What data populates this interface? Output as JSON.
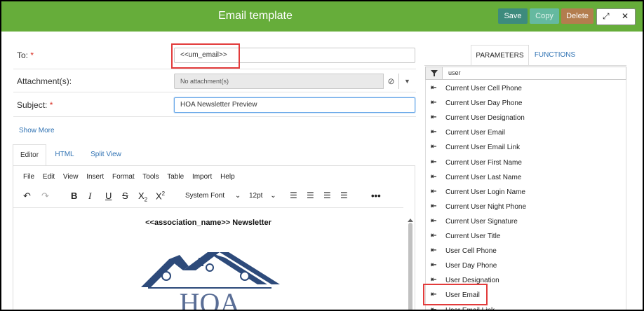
{
  "header": {
    "title": "Email template",
    "save_label": "Save",
    "copy_label": "Copy",
    "delete_label": "Delete",
    "expand_icon": "expand-icon",
    "close_icon": "close-icon"
  },
  "form": {
    "to_label": "To:",
    "to_value": "<<um_email>>",
    "attachments_label": "Attachment(s):",
    "attachments_value": "No attachment(s)",
    "subject_label": "Subject:",
    "subject_value": "HOA Newsletter Preview",
    "required_mark": "*",
    "show_more": "Show More"
  },
  "editor": {
    "tabs": [
      {
        "label": "Editor",
        "active": true
      },
      {
        "label": "HTML",
        "active": false
      },
      {
        "label": "Split View",
        "active": false
      }
    ],
    "menu": [
      "File",
      "Edit",
      "View",
      "Insert",
      "Format",
      "Tools",
      "Table",
      "Import",
      "Help"
    ],
    "font_family": "System Font",
    "font_size": "12pt",
    "doc_heading": "<<association_name>> Newsletter",
    "logo_text": "HOA"
  },
  "panel": {
    "tabs": [
      {
        "label": "PARAMETERS",
        "active": true
      },
      {
        "label": "FUNCTIONS",
        "active": false
      }
    ],
    "filter_value": "user",
    "items": [
      "Current User Cell Phone",
      "Current User Day Phone",
      "Current User Designation",
      "Current User Email",
      "Current User Email Link",
      "Current User First Name",
      "Current User Last Name",
      "Current User Login Name",
      "Current User Night Phone",
      "Current User Signature",
      "Current User Title",
      "User Cell Phone",
      "User Day Phone",
      "User Designation",
      "User Email",
      "User Email Link"
    ],
    "highlighted_item": "User Email"
  },
  "colors": {
    "header_green": "#66ad3a",
    "save": "#3d8b7d",
    "copy": "#65b9a0",
    "delete": "#b37d4e",
    "highlight_red": "#e23b3b",
    "link_blue": "#2f72b3",
    "logo_navy": "#2d4a7a"
  }
}
